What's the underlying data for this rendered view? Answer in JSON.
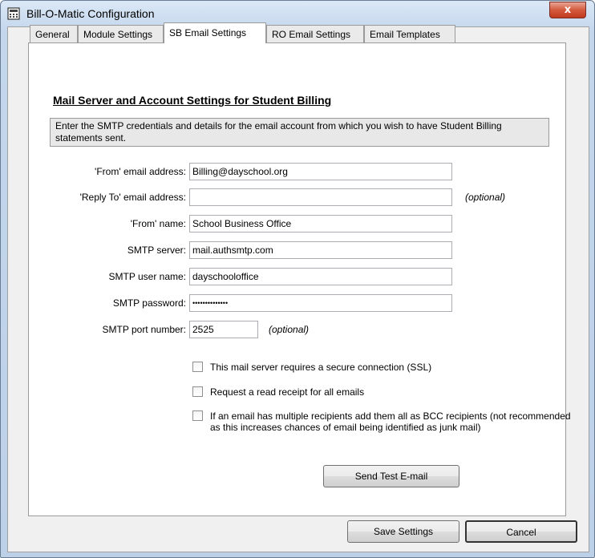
{
  "window": {
    "title": "Bill-O-Matic Configuration",
    "close_glyph": "x"
  },
  "tabs": [
    {
      "label": "General"
    },
    {
      "label": "Module Settings"
    },
    {
      "label": "SB Email Settings"
    },
    {
      "label": "RO Email Settings"
    },
    {
      "label": "Email Templates"
    }
  ],
  "section": {
    "title": "Mail Server and Account Settings for Student Billing",
    "info": "Enter the SMTP credentials and details for the email account from which you wish to have Student Billing statements sent."
  },
  "fields": {
    "from_email": {
      "label": "'From' email address:",
      "value": "Billing@dayschool.org"
    },
    "reply_to": {
      "label": "'Reply To' email address:",
      "value": "",
      "note": "(optional)"
    },
    "from_name": {
      "label": "'From' name:",
      "value": "School Business Office"
    },
    "smtp_server": {
      "label": "SMTP server:",
      "value": "mail.authsmtp.com"
    },
    "smtp_user": {
      "label": "SMTP user name:",
      "value": "dayschooloffice"
    },
    "smtp_password": {
      "label": "SMTP password:",
      "value": "••••••••••••••"
    },
    "smtp_port": {
      "label": "SMTP port number:",
      "value": "2525",
      "note": "(optional)"
    }
  },
  "options": {
    "ssl": {
      "label": "This mail server requires a secure connection (SSL)",
      "checked": false
    },
    "read_receipt": {
      "label": "Request a read receipt for all emails",
      "checked": false
    },
    "bcc": {
      "label": "If an email has multiple recipients add them all as BCC recipients (not recommended as this increases chances of email being identified as junk mail)",
      "checked": false
    }
  },
  "buttons": {
    "send_test": "Send Test E-mail",
    "save": "Save Settings",
    "cancel": "Cancel"
  },
  "colors": {
    "close_button": "#c13a1f",
    "title_gradient": "#c3d6ec"
  },
  "icons": {
    "app": "window-app-icon",
    "close": "close-icon"
  }
}
